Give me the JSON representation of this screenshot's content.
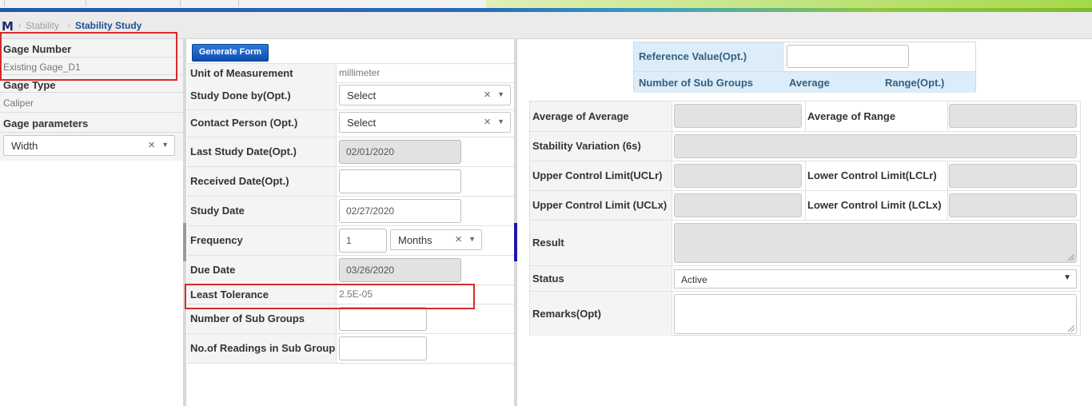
{
  "breadcrumb": {
    "logo": "M",
    "items": [
      "Stability",
      "Stability Study"
    ]
  },
  "left_panel": {
    "gage_number": {
      "label": "Gage Number",
      "value": "Existing Gage_D1"
    },
    "gage_type": {
      "label": "Gage Type",
      "value": "Caliper"
    },
    "gage_parameters": {
      "label": "Gage parameters",
      "value": "Width"
    }
  },
  "form": {
    "generate_button": "Generate Form",
    "unit_of_measurement": {
      "label": "Unit of Measurement",
      "value": "millimeter"
    },
    "study_done_by": {
      "label": "Study Done by(Opt.)",
      "value": "Select"
    },
    "contact_person": {
      "label": "Contact Person (Opt.)",
      "value": "Select"
    },
    "last_study_date": {
      "label": "Last Study Date(Opt.)",
      "value": "02/01/2020"
    },
    "received_date": {
      "label": "Received Date(Opt.)",
      "value": ""
    },
    "study_date": {
      "label": "Study Date",
      "value": "02/27/2020"
    },
    "frequency": {
      "label": "Frequency",
      "value": "1",
      "unit": "Months"
    },
    "due_date": {
      "label": "Due Date",
      "value": "03/26/2020"
    },
    "least_tolerance": {
      "label": "Least Tolerance",
      "value": "2.5E-05"
    },
    "number_of_sub_groups": {
      "label": "Number of Sub Groups",
      "value": ""
    },
    "readings_in_sub_group": {
      "label": "No.of Readings in Sub Group",
      "value": ""
    }
  },
  "reference": {
    "label": "Reference Value(Opt.)",
    "value": "",
    "columns": [
      "Number of Sub Groups",
      "Average",
      "Range(Opt.)"
    ]
  },
  "results": {
    "average_of_average": "Average of Average",
    "average_of_range": "Average of Range",
    "stability_variation": "Stability Variation (6s)",
    "ucl_r": "Upper Control Limit(UCLr)",
    "lcl_r": "Lower Control Limit(LCLr)",
    "ucl_x": "Upper Control Limit (UCLx)",
    "lcl_x": "Lower Control Limit (LCLx)",
    "result": "Result",
    "status": {
      "label": "Status",
      "value": "Active"
    },
    "remarks": "Remarks(Opt)"
  }
}
